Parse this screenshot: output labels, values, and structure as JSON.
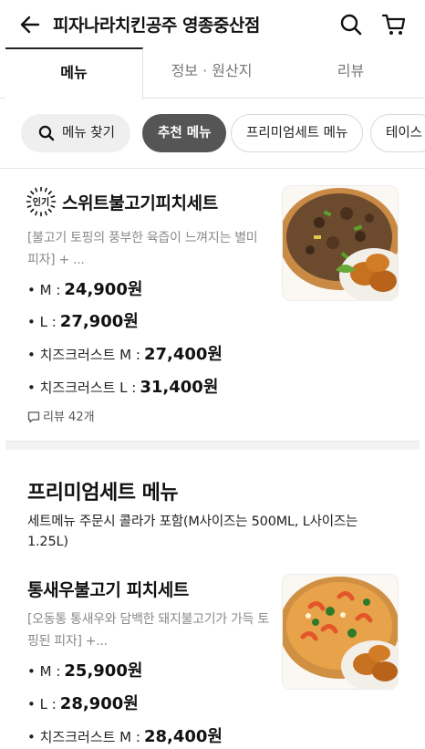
{
  "header": {
    "title": "피자나라치킨공주 영종중산점",
    "back_icon": "arrow-left-icon",
    "search_icon": "search-icon",
    "cart_icon": "cart-icon"
  },
  "tabs": [
    {
      "label": "메뉴",
      "active": true
    },
    {
      "label": "정보 · 원산지",
      "active": false
    },
    {
      "label": "리뷰",
      "active": false
    }
  ],
  "chips": [
    {
      "label": "메뉴 찾기",
      "icon": "search-icon"
    },
    {
      "label": "추천 메뉴",
      "active": true
    },
    {
      "label": "프리미엄세트 메뉴"
    },
    {
      "label": "테이스"
    }
  ],
  "items": [
    {
      "badge": "인기",
      "name": "스위트불고기피치세트",
      "description": "[불고기 토핑의 풍부한 육즙이 느껴지는 별미 피자] + ...",
      "prices": [
        {
          "label": "• M :",
          "amount": "24,900원"
        },
        {
          "label": "• L :",
          "amount": "27,900원"
        },
        {
          "label": "• 치즈크러스트 M :",
          "amount": "27,400원"
        },
        {
          "label": "• 치즈크러스트 L :",
          "amount": "31,400원"
        }
      ],
      "review": "리뷰 42개"
    },
    {
      "name": "통새우불고기 피치세트",
      "description": "[오동통 통새우와 담백한 돼지불고기가 가득 토핑된 피자] +...",
      "prices": [
        {
          "label": "• M :",
          "amount": "25,900원"
        },
        {
          "label": "• L :",
          "amount": "28,900원"
        },
        {
          "label": "• 치즈크러스트 M :",
          "amount": "28,400원"
        }
      ]
    }
  ],
  "section": {
    "title": "프리미엄세트 메뉴",
    "description": "세트메뉴 주문시 콜라가 포함(M사이즈는 500ML, L사이즈는 1.25L)"
  }
}
